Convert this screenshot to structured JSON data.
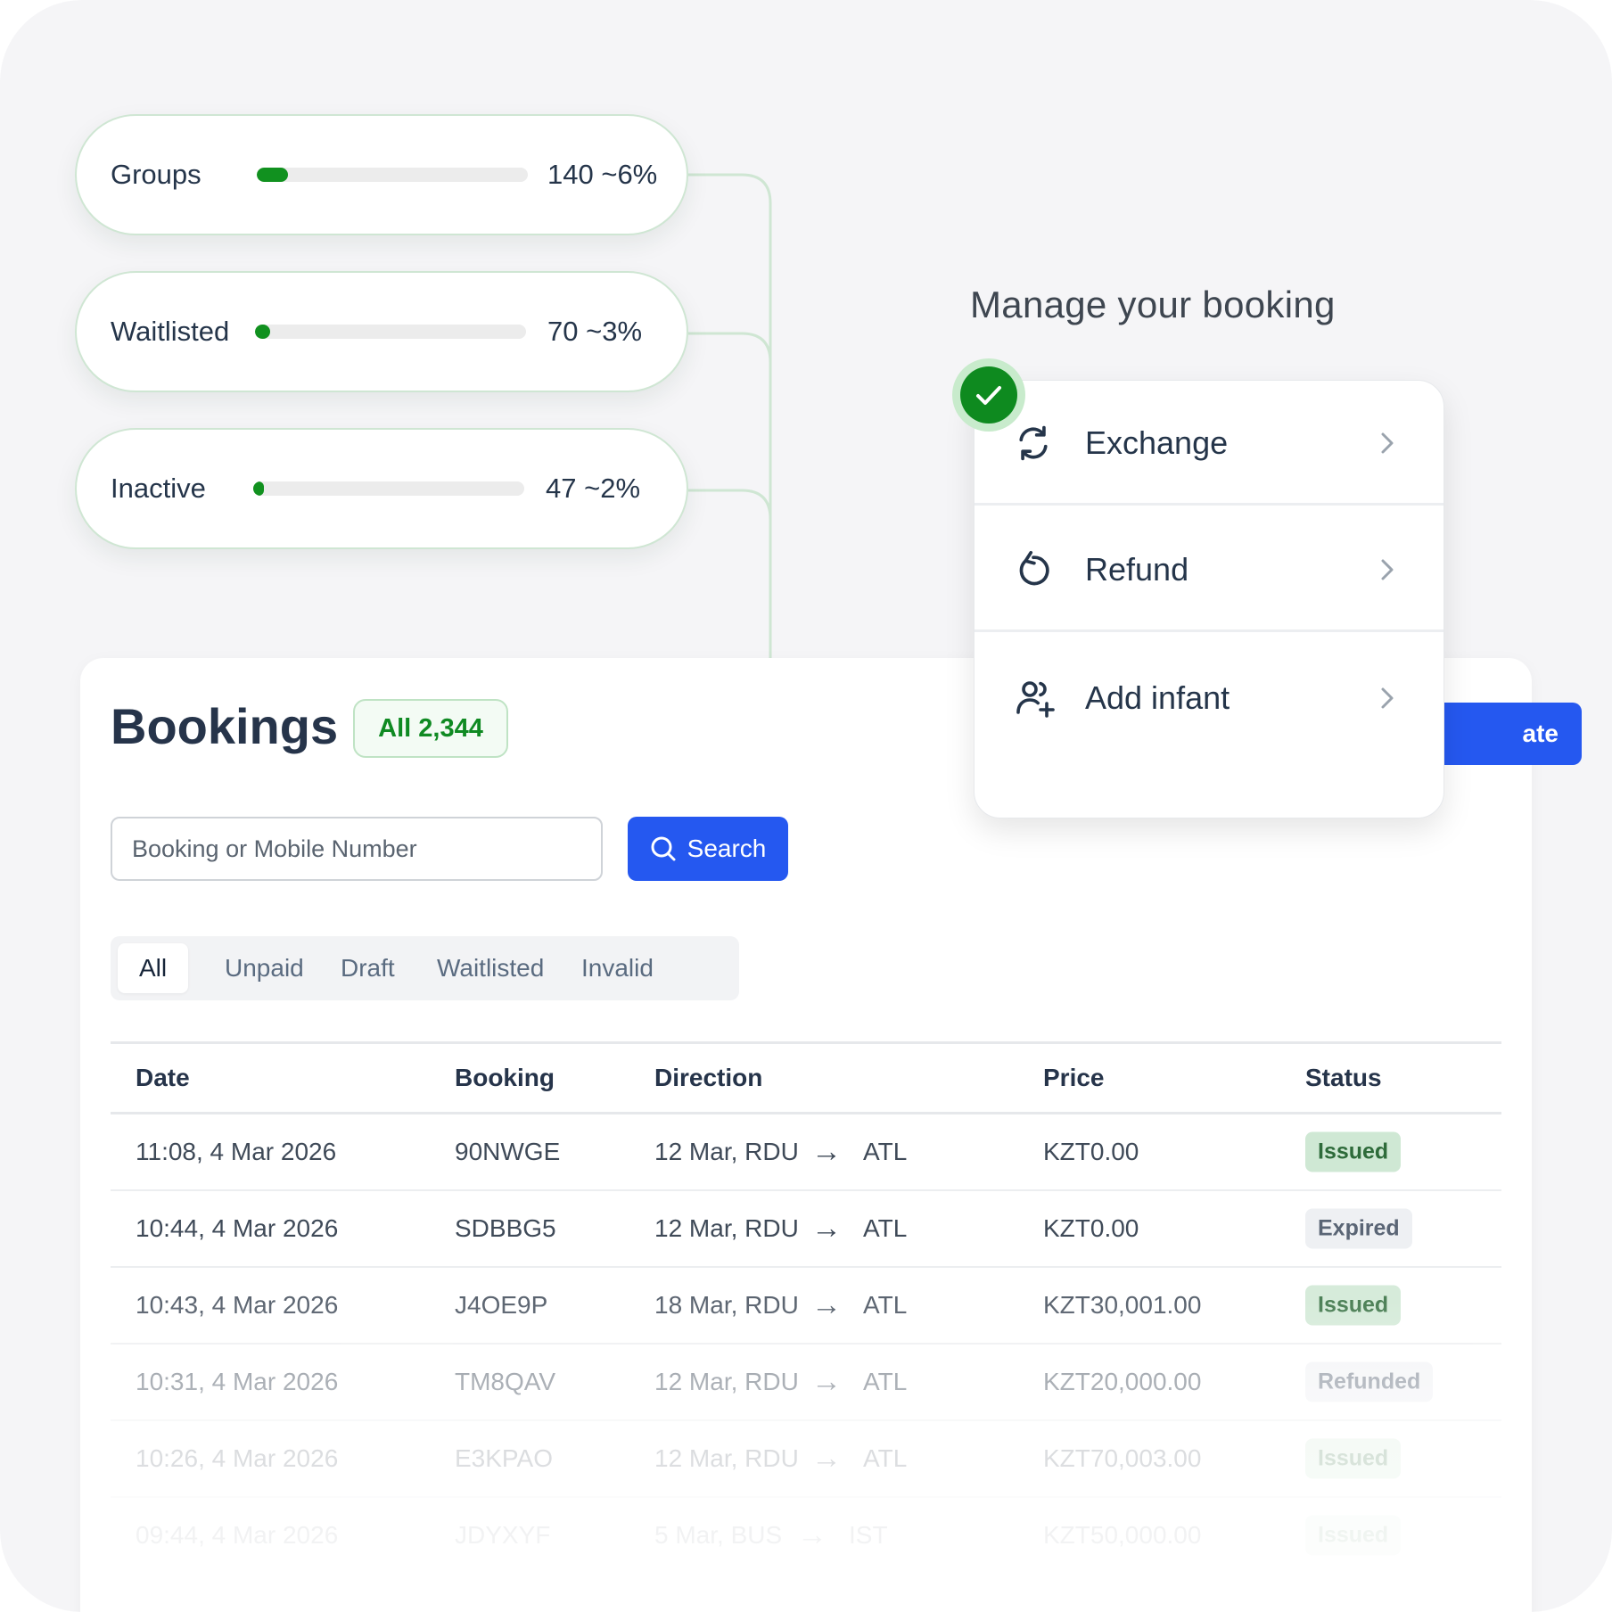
{
  "stats": [
    {
      "label": "Groups",
      "value": "140 ~6%",
      "fraction": 0.06
    },
    {
      "label": "Waitlisted",
      "value": "70 ~3%",
      "fraction": 0.03
    },
    {
      "label": "Inactive",
      "value": "47 ~2%",
      "fraction": 0.02
    }
  ],
  "manage": {
    "title": "Manage your booking",
    "items": [
      {
        "label": "Exchange",
        "icon": "exchange-icon"
      },
      {
        "label": "Refund",
        "icon": "refund-icon"
      },
      {
        "label": "Add infant",
        "icon": "add-user-icon"
      }
    ]
  },
  "bookings": {
    "title": "Bookings",
    "all_badge": "All 2,344",
    "create_label": "ate",
    "search": {
      "placeholder": "Booking or Mobile Number",
      "button_label": "Search"
    },
    "tabs": [
      "All",
      "Unpaid",
      "Draft",
      "Waitlisted",
      "Invalid"
    ],
    "active_tab": "All",
    "columns": [
      "Date",
      "Booking",
      "Direction",
      "Price",
      "Status"
    ],
    "rows": [
      {
        "date": "11:08, 4 Mar 2026",
        "booking": "90NWGE",
        "dir_from": "12 Mar, RDU",
        "dir_to": "ATL",
        "price": "KZT0.00",
        "status": "Issued"
      },
      {
        "date": "10:44, 4 Mar 2026",
        "booking": "SDBBG5",
        "dir_from": "12 Mar, RDU",
        "dir_to": "ATL",
        "price": "KZT0.00",
        "status": "Expired"
      },
      {
        "date": "10:43, 4 Mar 2026",
        "booking": "J4OE9P",
        "dir_from": "18 Mar, RDU",
        "dir_to": "ATL",
        "price": "KZT30,001.00",
        "status": "Issued"
      },
      {
        "date": "10:31, 4 Mar 2026",
        "booking": "TM8QAV",
        "dir_from": "12 Mar, RDU",
        "dir_to": "ATL",
        "price": "KZT20,000.00",
        "status": "Refunded"
      },
      {
        "date": "10:26, 4 Mar 2026",
        "booking": "E3KPAO",
        "dir_from": "12 Mar, RDU",
        "dir_to": "ATL",
        "price": "KZT70,003.00",
        "status": "Issued"
      },
      {
        "date": "09:44, 4 Mar 2026",
        "booking": "JDYXYF",
        "dir_from": "5 Mar, BUS",
        "dir_to": "IST",
        "price": "KZT50,000.00",
        "status": "Issued"
      }
    ]
  },
  "colors": {
    "accent": "#2558f0",
    "success": "#0e8a1f",
    "text": "#25354a"
  }
}
